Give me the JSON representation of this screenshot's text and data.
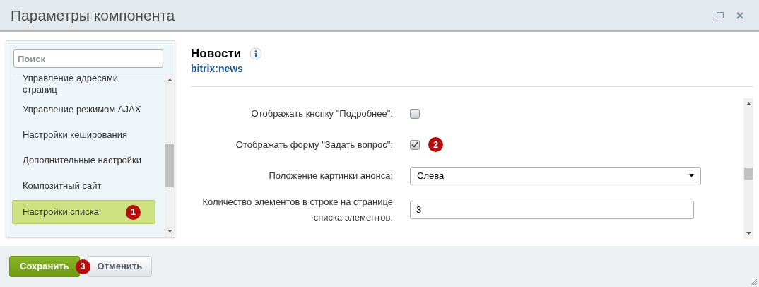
{
  "window": {
    "title": "Параметры компонента"
  },
  "sidebar": {
    "search": {
      "placeholder": "Поиск"
    },
    "items": [
      {
        "label": "Управление адресами страниц",
        "selected": false
      },
      {
        "label": "Управление режимом AJAX",
        "selected": false
      },
      {
        "label": "Настройки кеширования",
        "selected": false
      },
      {
        "label": "Дополнительные настройки",
        "selected": false
      },
      {
        "label": "Композитный сайт",
        "selected": false
      },
      {
        "label": "Настройки списка",
        "selected": true,
        "badge": "1"
      }
    ]
  },
  "component": {
    "name": "Новости",
    "code": "bitrix:news"
  },
  "params": [
    {
      "kind": "checkbox",
      "label": "Отображать кнопку \"Подробнее\":",
      "checked": false
    },
    {
      "kind": "checkbox",
      "label": "Отображать форму \"Задать вопрос\":",
      "checked": true,
      "badge": "2"
    },
    {
      "kind": "select",
      "label": "Положение картинки анонса:",
      "value": "Слева"
    },
    {
      "kind": "text",
      "label": "Количество элементов в строке на странице списка элементов:",
      "value": "3"
    }
  ],
  "buttons": [
    {
      "kind": "primary",
      "label": "Сохранить",
      "badge": "3"
    },
    {
      "kind": "secondary",
      "label": "Отменить"
    }
  ]
}
